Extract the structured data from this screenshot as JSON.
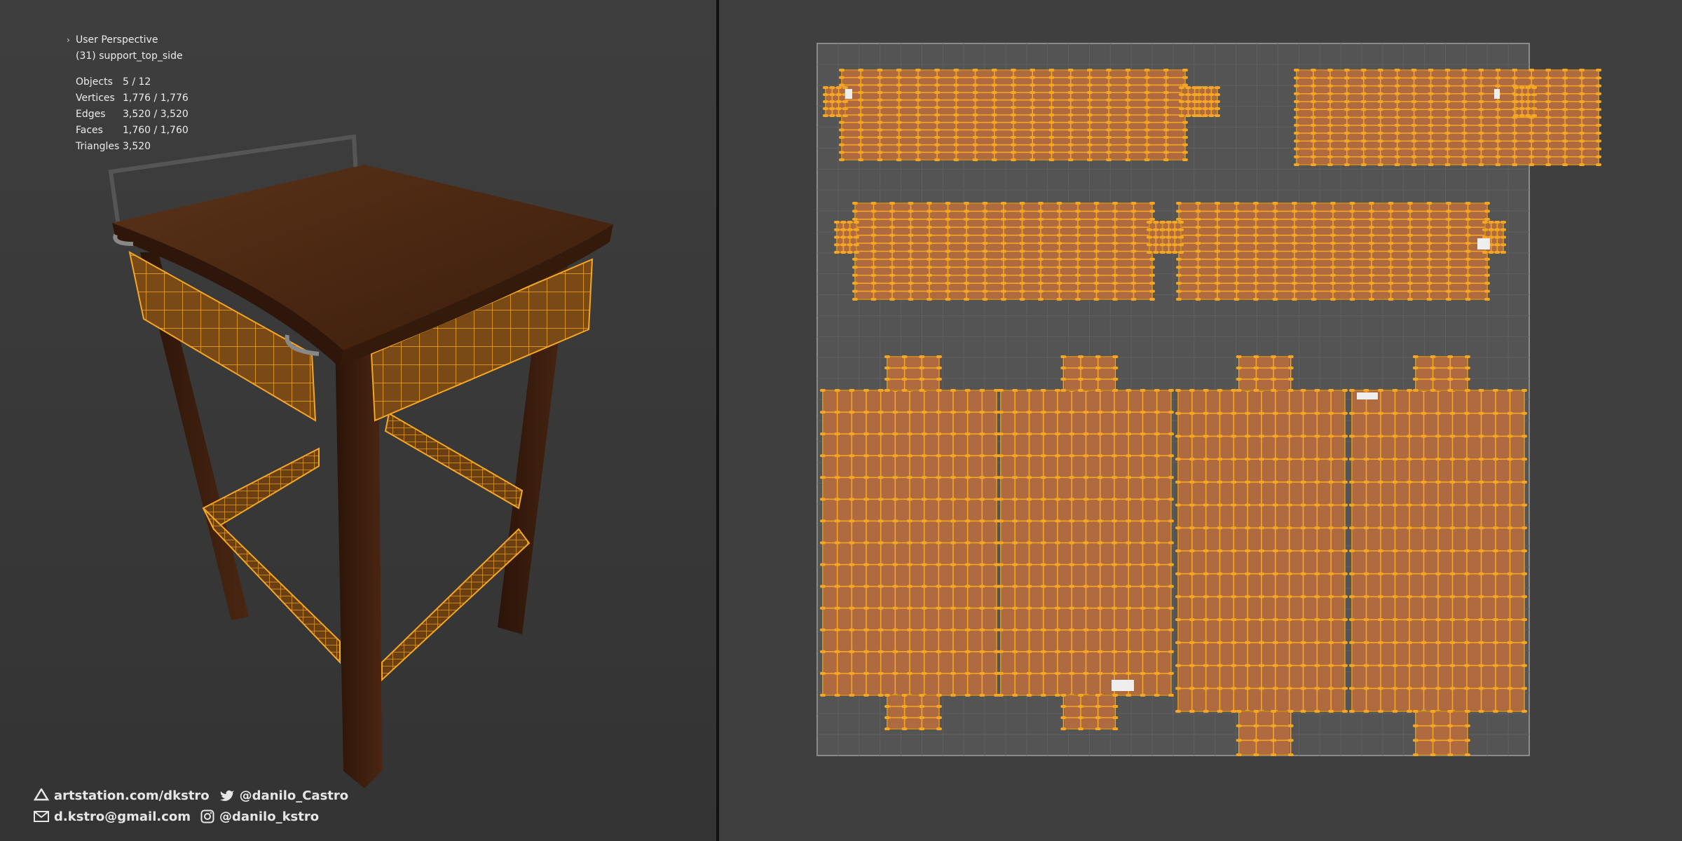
{
  "viewport": {
    "view_name": "User Perspective",
    "object_name": "(31) support_top_side",
    "stats": [
      {
        "label": "Objects",
        "value": "5 / 12"
      },
      {
        "label": "Vertices",
        "value": "1,776 / 1,776"
      },
      {
        "label": "Edges",
        "value": "3,520 / 3,520"
      },
      {
        "label": "Faces",
        "value": "1,760 / 1,760"
      },
      {
        "label": "Triangles",
        "value": "3,520"
      }
    ]
  },
  "footer": {
    "website": "artstation.com/dkstro",
    "twitter": "@danilo_Castro",
    "email": "d.kstro@gmail.com",
    "instagram": "@danilo_kstro"
  },
  "colors": {
    "selection": "#f5a623",
    "uv_fill": "#b06a3f",
    "wood_dark": "#3a1e0e"
  }
}
